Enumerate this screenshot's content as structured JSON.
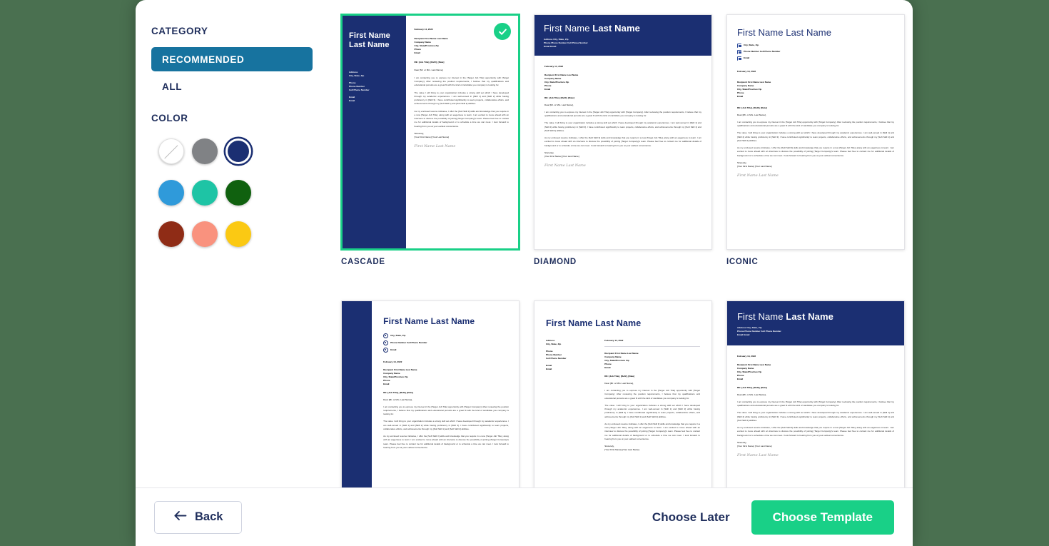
{
  "sidebar": {
    "category_heading": "CATEGORY",
    "categories": [
      {
        "label": "RECOMMENDED",
        "selected": true
      },
      {
        "label": "ALL",
        "selected": false
      }
    ],
    "color_heading": "COLOR",
    "colors": [
      {
        "name": "none",
        "hex": "#ffffff",
        "selected": false
      },
      {
        "name": "gray",
        "hex": "#808285",
        "selected": false
      },
      {
        "name": "navy",
        "hex": "#1b2f72",
        "selected": true
      },
      {
        "name": "light-blue",
        "hex": "#2f9ada",
        "selected": false
      },
      {
        "name": "teal",
        "hex": "#1ec4a5",
        "selected": false
      },
      {
        "name": "dark-green",
        "hex": "#10610f",
        "selected": false
      },
      {
        "name": "rust",
        "hex": "#8f2c16",
        "selected": false
      },
      {
        "name": "salmon",
        "hex": "#f9927e",
        "selected": false
      },
      {
        "name": "yellow",
        "hex": "#fbc913",
        "selected": false
      }
    ]
  },
  "letter": {
    "first_name": "First Name",
    "last_name": "Last Name",
    "full_name": "First Name Last Name",
    "address_label": "Address",
    "address_value": "City, State, Zip",
    "phone_label": "Phone",
    "phone_value": "Phone Number",
    "cell_value": "Cell Phone Number",
    "email_label": "Email",
    "email_value": "Email",
    "inline_address": "Address  City, State, Zip",
    "inline_phone": "Phone  Phone Number  Cell Phone Number",
    "inline_email": "Email  Email",
    "icon_address": "City, State, Zip",
    "icon_phone": "Phone Number  Cell Phone Number",
    "icon_email": "Email",
    "date": "February 14, 2022",
    "recipient_name": "Recipient First Name Last Name",
    "recipient_company": "Company Name",
    "recipient_city": "City, State/Province Zip",
    "recipient_phone": "Phone",
    "recipient_email": "Email",
    "subject": "RE: [Job Title], [Ref#], [Date]",
    "salutation": "Dear [Mr. or Mrs. Last Name],",
    "p1": "I am contacting you to express my interest in the [Target Job Title] opportunity with [Target Company]. After reviewing the position requirements, I believe that my qualifications and educational pursuits are a great fit with the kind of candidate you company is looking for.",
    "p2": "The value I will bring to your organization includes a strong skill set which I have developed through my academic experiences. I am well-versed in [Skill 1] and [Skill 2] while having proficiency in [Skill 3]. I have contributed significantly to team projects, collaborative efforts, and achievements through my [Soft Skill 1] and [Soft Skill 2] abilities.",
    "p3": "As my enclosed resume indicates, I offer the [Soft Skill 3] skills and knowledge that you require in a new [Target Job Title], along with an eagerness to learn. I am excited to move ahead with an interview to discuss the possibility of joining [Target Company]'s team. Please feel free to contact me for additional details of background or to schedule a time we can meet. I look forward to hearing from you at your earliest convenience.",
    "closing": "Sincerely,",
    "signer": "[Your First Name] [Your Last Name]",
    "signature": "First Name Last Name"
  },
  "templates": [
    {
      "id": "cascade",
      "label": "CASCADE",
      "selected": true,
      "layout": "left-navy-panel"
    },
    {
      "id": "diamond",
      "label": "DIAMOND",
      "selected": false,
      "layout": "navy-header-band"
    },
    {
      "id": "iconic",
      "label": "ICONIC",
      "selected": false,
      "layout": "icon-square-header"
    },
    {
      "id": "template-4",
      "label": "",
      "selected": false,
      "layout": "navy-stripe-icons"
    },
    {
      "id": "template-5",
      "label": "",
      "selected": false,
      "layout": "two-column"
    },
    {
      "id": "template-6",
      "label": "",
      "selected": false,
      "layout": "navy-header-band"
    }
  ],
  "footer": {
    "back_label": "Back",
    "back_icon": "arrow-left-icon",
    "choose_later_label": "Choose Later",
    "choose_template_label": "Choose Template"
  },
  "theme": {
    "accent_green": "#19d087",
    "navy": "#1b2f72",
    "category_blue": "#17739f",
    "page_background": "#4a7050"
  }
}
